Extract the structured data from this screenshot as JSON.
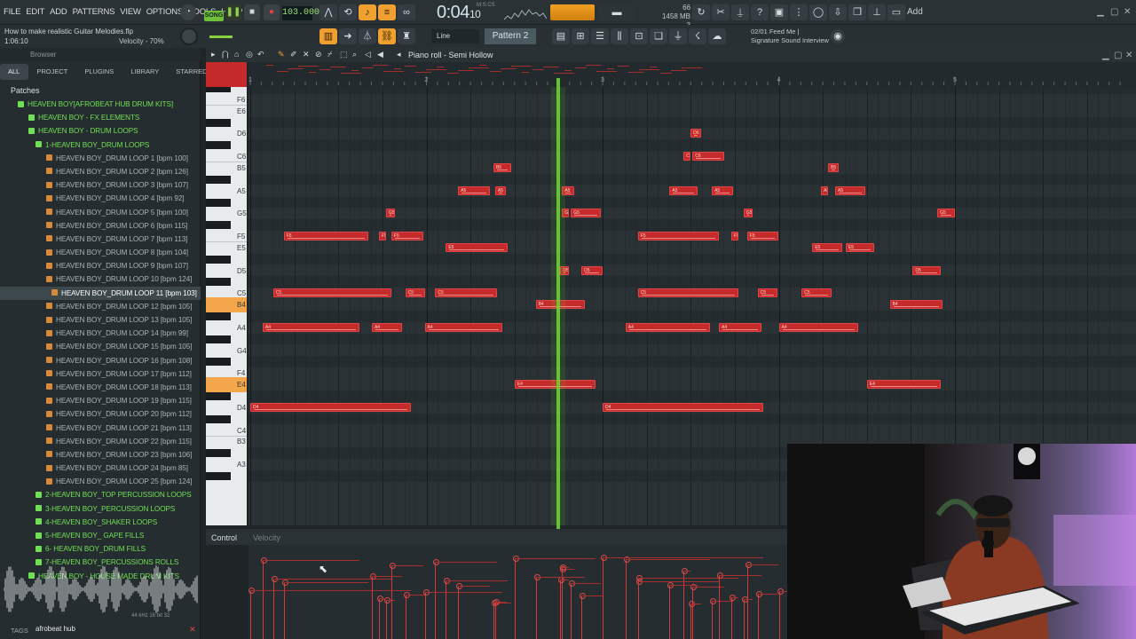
{
  "menu": [
    "FILE",
    "EDIT",
    "ADD",
    "PATTERNS",
    "VIEW",
    "OPTIONS",
    "TOOLS",
    "HELP"
  ],
  "transport": {
    "song_label": "SONG",
    "tempo": "103.000",
    "time": "0:04",
    "time_small": "10",
    "mics": "M:S:CS"
  },
  "cpu": {
    "line1": "1458 MB",
    "line2": "66",
    "line3": "3"
  },
  "add_label": "Add",
  "project": {
    "title": "How to make realistic Guitar Melodies.flp",
    "time": "1:06:10",
    "hint": "Velocity - 70%"
  },
  "toolbar2": {
    "line_mode": "Line",
    "pattern": "Pattern 2"
  },
  "song_info": {
    "line1": "02/01  Feed Me |",
    "line2": "Signature Sound Interview"
  },
  "browser": {
    "header": "Browser",
    "tabs": [
      "ALL",
      "PROJECT",
      "PLUGINS",
      "LIBRARY",
      "STARRED"
    ],
    "root": "Patches",
    "items": [
      {
        "label": "HEAVEN BOY[AFROBEAT HUB DRUM KITS]",
        "type": "folder",
        "indent": 20
      },
      {
        "label": "HEAVEN BOY -  FX ELEMENTS",
        "type": "folder",
        "indent": 32
      },
      {
        "label": "HEAVEN BOY - DRUM LOOPS",
        "type": "folder",
        "indent": 32
      },
      {
        "label": "1-HEAVEN BOY_DRUM LOOPS",
        "type": "folder",
        "indent": 40
      },
      {
        "label": "HEAVEN BOY_DRUM LOOP 1 [bpm 100]",
        "type": "file",
        "indent": 52
      },
      {
        "label": "HEAVEN BOY_DRUM LOOP 2 [bpm 126]",
        "type": "file",
        "indent": 52
      },
      {
        "label": "HEAVEN BOY_DRUM LOOP 3 [bpm 107]",
        "type": "file",
        "indent": 52
      },
      {
        "label": "HEAVEN BOY_DRUM LOOP 4 [bpm 92]",
        "type": "file",
        "indent": 52
      },
      {
        "label": "HEAVEN BOY_DRUM LOOP 5 [bpm 100]",
        "type": "file",
        "indent": 52
      },
      {
        "label": "HEAVEN BOY_DRUM LOOP 6 [bpm 115]",
        "type": "file",
        "indent": 52
      },
      {
        "label": "HEAVEN BOY_DRUM LOOP 7 [bpm 113]",
        "type": "file",
        "indent": 52
      },
      {
        "label": "HEAVEN BOY_DRUM LOOP 8 [bpm 104]",
        "type": "file",
        "indent": 52
      },
      {
        "label": "HEAVEN BOY_DRUM LOOP 9 [bpm 107]",
        "type": "file",
        "indent": 52
      },
      {
        "label": "HEAVEN BOY_DRUM LOOP 10 [bpm 124]",
        "type": "file",
        "indent": 52
      },
      {
        "label": "HEAVEN BOY_DRUM LOOP 11 [bpm 103]",
        "type": "file",
        "indent": 58,
        "selected": true
      },
      {
        "label": "HEAVEN BOY_DRUM LOOP 12 [bpm 105]",
        "type": "file",
        "indent": 52
      },
      {
        "label": "HEAVEN BOY_DRUM LOOP 13 [bpm 105]",
        "type": "file",
        "indent": 52
      },
      {
        "label": "HEAVEN BOY_DRUM LOOP 14 [bpm 99]",
        "type": "file",
        "indent": 52
      },
      {
        "label": "HEAVEN BOY_DRUM LOOP 15 [bpm 105]",
        "type": "file",
        "indent": 52
      },
      {
        "label": "HEAVEN BOY_DRUM LOOP 16 [bpm 108]",
        "type": "file",
        "indent": 52
      },
      {
        "label": "HEAVEN BOY_DRUM LOOP 17 [bpm 112]",
        "type": "file",
        "indent": 52
      },
      {
        "label": "HEAVEN BOY_DRUM LOOP 18 [bpm 113]",
        "type": "file",
        "indent": 52
      },
      {
        "label": "HEAVEN BOY_DRUM LOOP 19 [bpm 115]",
        "type": "file",
        "indent": 52
      },
      {
        "label": "HEAVEN BOY_DRUM LOOP 20 [bpm 112]",
        "type": "file",
        "indent": 52
      },
      {
        "label": "HEAVEN BOY_DRUM LOOP 21 [bpm 113]",
        "type": "file",
        "indent": 52
      },
      {
        "label": "HEAVEN BOY_DRUM LOOP 22 [bpm 115]",
        "type": "file",
        "indent": 52
      },
      {
        "label": "HEAVEN BOY_DRUM LOOP 23 [bpm 106]",
        "type": "file",
        "indent": 52
      },
      {
        "label": "HEAVEN BOY_DRUM LOOP 24 [bpm 85]",
        "type": "file",
        "indent": 52
      },
      {
        "label": "HEAVEN BOY_DRUM LOOP 25 [bpm 124]",
        "type": "file",
        "indent": 52
      },
      {
        "label": "2-HEAVEN BOY_TOP PERCUSSION LOOPS",
        "type": "folder",
        "indent": 40
      },
      {
        "label": "3-HEAVEN BOY_PERCUSSION LOOPS",
        "type": "folder",
        "indent": 40
      },
      {
        "label": "4-HEAVEN BOY_SHAKER LOOPS",
        "type": "folder",
        "indent": 40
      },
      {
        "label": "5-HEAVEN BOY_ GAPE FILLS",
        "type": "folder",
        "indent": 40
      },
      {
        "label": "6- HEAVEN BOY_DRUM FILLS",
        "type": "folder",
        "indent": 40
      },
      {
        "label": "7-HEAVEN BOY_PERCUSSIONS ROLLS",
        "type": "folder",
        "indent": 40
      },
      {
        "label": "HEAVEN BOY - HOUSE MADE DRUM KITS",
        "type": "folder",
        "indent": 32
      }
    ],
    "wave_info": "44 kHz 16 bit 32",
    "tags_label": "TAGS",
    "tags_value": "afrobeat hub"
  },
  "piano_roll": {
    "title": "Piano roll - Semi Hollow",
    "bar_numbers": [
      "1",
      "2",
      "3",
      "4",
      "5"
    ],
    "key_labels": [
      "F6",
      "E6",
      "D6",
      "C6",
      "B5",
      "A5",
      "G5",
      "F5",
      "E5",
      "D5",
      "C5",
      "B4",
      "A4",
      "G4",
      "F4",
      "E4",
      "D4",
      "C4",
      "B3",
      "A3"
    ],
    "highlighted_keys": [
      "B4",
      "E4"
    ],
    "notes": [
      {
        "pitch": "D6",
        "start": 3.5,
        "len": 0.06
      },
      {
        "pitch": "C6",
        "start": 3.46,
        "len": 0.04
      },
      {
        "pitch": "C6",
        "start": 3.51,
        "len": 0.18
      },
      {
        "pitch": "B5",
        "start": 2.38,
        "len": 0.1
      },
      {
        "pitch": "B5",
        "start": 4.28,
        "len": 0.06
      },
      {
        "pitch": "A5",
        "start": 2.18,
        "len": 0.18
      },
      {
        "pitch": "A5",
        "start": 2.39,
        "len": 0.06
      },
      {
        "pitch": "A5",
        "start": 2.77,
        "len": 0.07
      },
      {
        "pitch": "A5",
        "start": 3.38,
        "len": 0.16
      },
      {
        "pitch": "A5",
        "start": 3.62,
        "len": 0.12
      },
      {
        "pitch": "A5",
        "start": 4.24,
        "len": 0.04
      },
      {
        "pitch": "A5",
        "start": 4.32,
        "len": 0.17
      },
      {
        "pitch": "G5",
        "start": 1.77,
        "len": 0.05
      },
      {
        "pitch": "G5",
        "start": 2.77,
        "len": 0.04
      },
      {
        "pitch": "G5",
        "start": 2.82,
        "len": 0.17
      },
      {
        "pitch": "G5",
        "start": 3.8,
        "len": 0.05
      },
      {
        "pitch": "G5",
        "start": 4.9,
        "len": 0.1
      },
      {
        "pitch": "F5",
        "start": 1.19,
        "len": 0.48
      },
      {
        "pitch": "F5",
        "start": 1.73,
        "len": 0.04
      },
      {
        "pitch": "F5",
        "start": 1.8,
        "len": 0.18
      },
      {
        "pitch": "F5",
        "start": 3.2,
        "len": 0.46
      },
      {
        "pitch": "F5",
        "start": 3.73,
        "len": 0.04
      },
      {
        "pitch": "F5",
        "start": 3.82,
        "len": 0.18
      },
      {
        "pitch": "E5",
        "start": 2.11,
        "len": 0.35
      },
      {
        "pitch": "E5",
        "start": 4.19,
        "len": 0.17
      },
      {
        "pitch": "E5",
        "start": 4.38,
        "len": 0.16
      },
      {
        "pitch": "D5",
        "start": 2.76,
        "len": 0.05
      },
      {
        "pitch": "D5",
        "start": 2.88,
        "len": 0.12
      },
      {
        "pitch": "D5",
        "start": 4.76,
        "len": 0.16
      },
      {
        "pitch": "C5",
        "start": 1.13,
        "len": 0.67
      },
      {
        "pitch": "C5",
        "start": 1.88,
        "len": 0.11
      },
      {
        "pitch": "C5",
        "start": 2.05,
        "len": 0.35
      },
      {
        "pitch": "C5",
        "start": 3.2,
        "len": 0.57
      },
      {
        "pitch": "C5",
        "start": 3.88,
        "len": 0.11
      },
      {
        "pitch": "C5",
        "start": 4.13,
        "len": 0.17
      },
      {
        "pitch": "B4",
        "start": 2.62,
        "len": 0.28
      },
      {
        "pitch": "B4",
        "start": 4.63,
        "len": 0.3
      },
      {
        "pitch": "A4",
        "start": 1.07,
        "len": 0.55
      },
      {
        "pitch": "A4",
        "start": 1.69,
        "len": 0.17
      },
      {
        "pitch": "A4",
        "start": 1.99,
        "len": 0.44
      },
      {
        "pitch": "A4",
        "start": 3.13,
        "len": 0.48
      },
      {
        "pitch": "A4",
        "start": 3.66,
        "len": 0.24
      },
      {
        "pitch": "A4",
        "start": 4.0,
        "len": 0.45
      },
      {
        "pitch": "E4",
        "start": 2.5,
        "len": 0.46
      },
      {
        "pitch": "E4",
        "start": 4.5,
        "len": 0.42
      },
      {
        "pitch": "D4",
        "start": 1.0,
        "len": 0.91
      },
      {
        "pitch": "D4",
        "start": 3.0,
        "len": 0.91
      }
    ],
    "playhead_bar": 2.74
  },
  "control": {
    "label": "Control",
    "param": "Velocity"
  }
}
